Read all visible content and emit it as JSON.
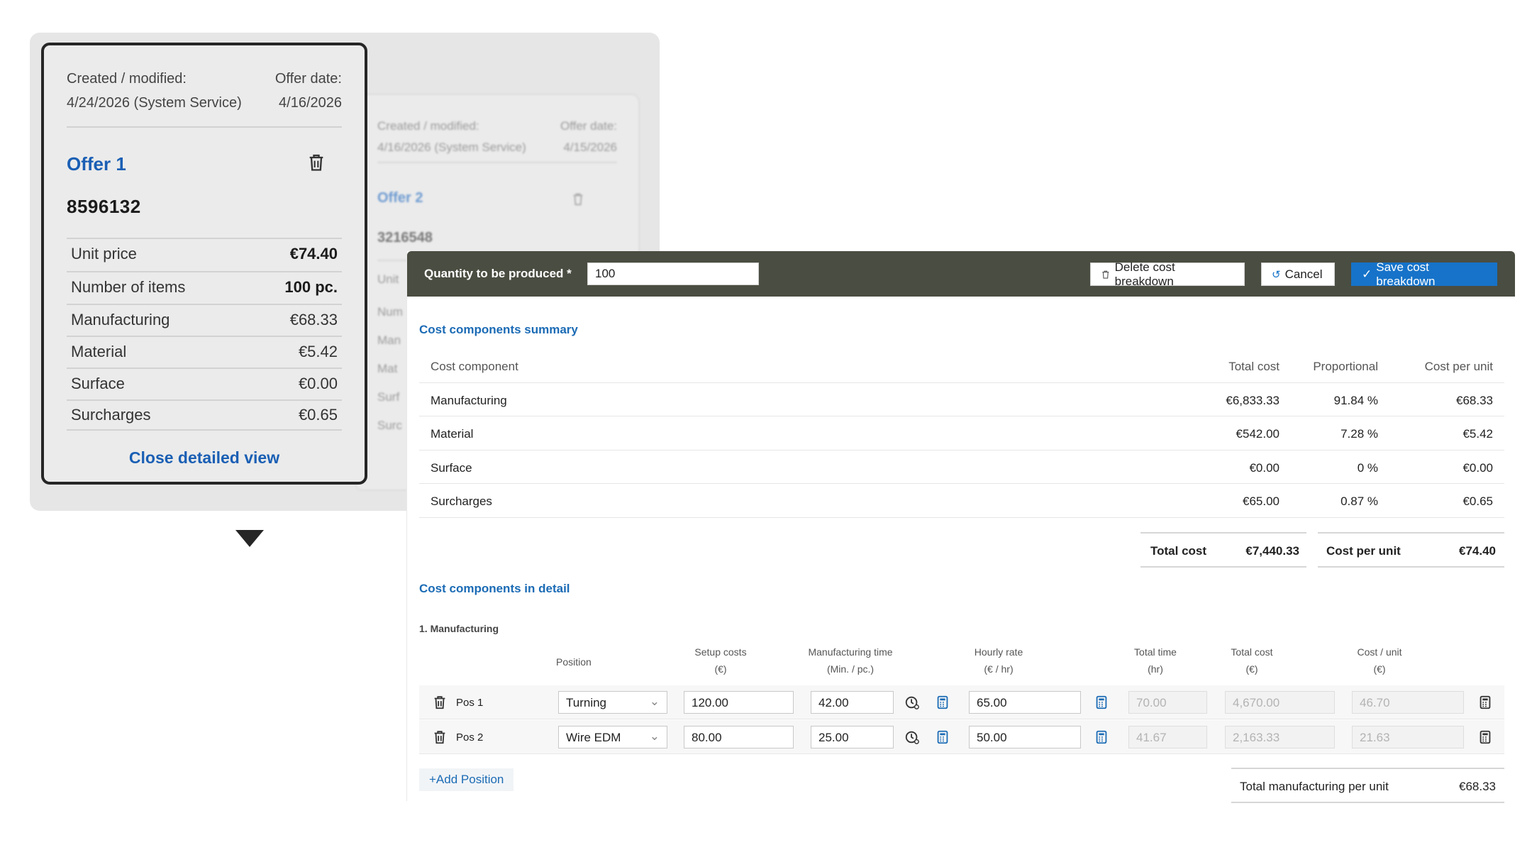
{
  "offer1": {
    "created_label": "Created / modified:",
    "created_value": "4/24/2026 (System Service)",
    "offer_date_label": "Offer date:",
    "offer_date_value": "4/16/2026",
    "title": "Offer 1",
    "number": "8596132",
    "rows": [
      {
        "label": "Unit price",
        "value": "€74.40"
      },
      {
        "label": "Number of items",
        "value": "100 pc."
      },
      {
        "label": "Manufacturing",
        "value": "€68.33"
      },
      {
        "label": "Material",
        "value": "€5.42"
      },
      {
        "label": "Surface",
        "value": "€0.00"
      },
      {
        "label": "Surcharges",
        "value": "€0.65"
      }
    ],
    "close_label": "Close detailed view"
  },
  "offer2": {
    "created_label": "Created / modified:",
    "created_value": "4/16/2026 (System Service)",
    "offer_date_label": "Offer date:",
    "offer_date_value": "4/15/2026",
    "title": "Offer 2",
    "number": "3216548",
    "row_stubs": [
      "Unit",
      "Num",
      "Man",
      "Mat",
      "Surf",
      "Surc"
    ]
  },
  "toolbar": {
    "qty_label": "Quantity to be produced *",
    "qty_value": "100",
    "delete_label": "Delete cost breakdown",
    "cancel_label": "Cancel",
    "save_label": "Save cost breakdown"
  },
  "summary": {
    "title": "Cost components summary",
    "headers": {
      "component": "Cost component",
      "total": "Total cost",
      "proportional": "Proportional",
      "per_unit": "Cost per unit"
    },
    "rows": [
      {
        "component": "Manufacturing",
        "total": "€6,833.33",
        "proportional": "91.84 %",
        "per_unit": "€68.33"
      },
      {
        "component": "Material",
        "total": "€542.00",
        "proportional": "7.28 %",
        "per_unit": "€5.42"
      },
      {
        "component": "Surface",
        "total": "€0.00",
        "proportional": "0 %",
        "per_unit": "€0.00"
      },
      {
        "component": "Surcharges",
        "total": "€65.00",
        "proportional": "0.87 %",
        "per_unit": "€0.65"
      }
    ],
    "total_cost_label": "Total cost",
    "total_cost_value": "€7,440.33",
    "cost_per_unit_label": "Cost per unit",
    "cost_per_unit_value": "€74.40"
  },
  "detail": {
    "title": "Cost components in detail",
    "section": "1. Manufacturing",
    "headers": {
      "position": "Position",
      "setup": "Setup costs",
      "setup_unit": "(€)",
      "mtime": "Manufacturing time",
      "mtime_unit": "(Min. / pc.)",
      "rate": "Hourly rate",
      "rate_unit": "(€ / hr)",
      "ttime": "Total time",
      "ttime_unit": "(hr)",
      "tcost": "Total cost",
      "tcost_unit": "(€)",
      "cpu": "Cost / unit",
      "cpu_unit": "(€)"
    },
    "positions": [
      {
        "name": "Pos 1",
        "process": "Turning",
        "setup": "120.00",
        "mtime": "42.00",
        "rate": "65.00",
        "ttime": "70.00",
        "tcost": "4,670.00",
        "cpu": "46.70"
      },
      {
        "name": "Pos 2",
        "process": "Wire EDM",
        "setup": "80.00",
        "mtime": "25.00",
        "rate": "50.00",
        "ttime": "41.67",
        "tcost": "2,163.33",
        "cpu": "21.63"
      }
    ],
    "add_position_label": "+Add Position",
    "total_mfg_label": "Total manufacturing per unit",
    "total_mfg_value": "€68.33"
  },
  "colors": {
    "accent": "#1a5fb4",
    "toolbar": "#4a4d41",
    "primary_button": "#1673c9"
  }
}
